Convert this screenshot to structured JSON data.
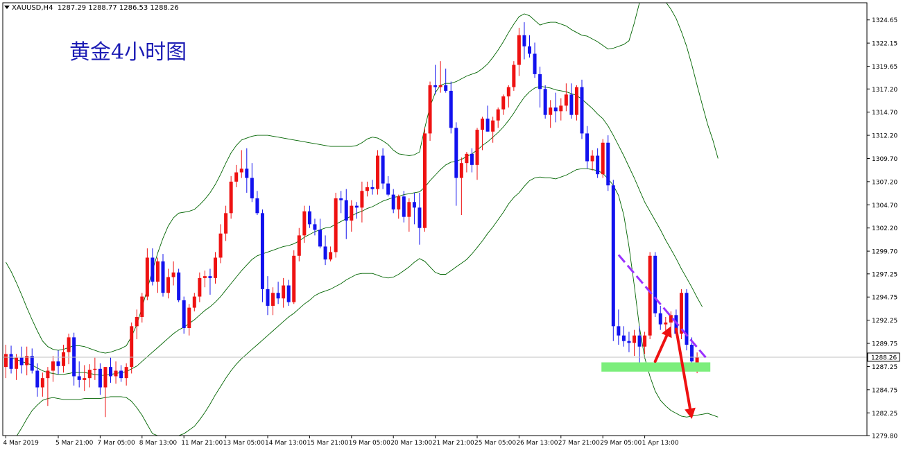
{
  "header": {
    "symbol": "XAUUSD,H4",
    "ohlc": "1287.29 1288.77 1286.53 1288.26"
  },
  "chart_data": {
    "type": "candlestick",
    "title": "黄金4小时图",
    "symbol": "XAUUSD",
    "timeframe": "H4",
    "current_price": 1288.26,
    "current_price_label": "1288.26",
    "ylim": [
      1279.8,
      1326.5
    ],
    "y_ticks": [
      "1324.65",
      "1322.15",
      "1319.65",
      "1317.20",
      "1314.70",
      "1312.20",
      "1309.70",
      "1307.20",
      "1304.70",
      "1302.20",
      "1299.70",
      "1297.25",
      "1294.75",
      "1292.25",
      "1289.75",
      "1287.25",
      "1284.75",
      "1282.25",
      "1279.80"
    ],
    "x_ticks": [
      {
        "label": "4 Mar 2019",
        "index": 0
      },
      {
        "label": "5 Mar 21:00",
        "index": 10
      },
      {
        "label": "7 Mar 05:00",
        "index": 18
      },
      {
        "label": "8 Mar 13:00",
        "index": 26
      },
      {
        "label": "11 Mar 21:00",
        "index": 34
      },
      {
        "label": "13 Mar 05:00",
        "index": 42
      },
      {
        "label": "14 Mar 13:00",
        "index": 50
      },
      {
        "label": "15 Mar 21:00",
        "index": 58
      },
      {
        "label": "19 Mar 05:00",
        "index": 66
      },
      {
        "label": "20 Mar 13:00",
        "index": 74
      },
      {
        "label": "21 Mar 21:00",
        "index": 82
      },
      {
        "label": "25 Mar 05:00",
        "index": 90
      },
      {
        "label": "26 Mar 13:00",
        "index": 98
      },
      {
        "label": "27 Mar 21:00",
        "index": 106
      },
      {
        "label": "29 Mar 05:00",
        "index": 114
      },
      {
        "label": "1 Apr 13:00",
        "index": 122
      }
    ],
    "candles": [
      [
        1287.2,
        1289.6,
        1286.0,
        1288.6
      ],
      [
        1288.6,
        1289.5,
        1286.5,
        1287.0
      ],
      [
        1287.0,
        1288.6,
        1285.8,
        1288.2
      ],
      [
        1288.2,
        1289.4,
        1286.5,
        1287.4
      ],
      [
        1287.4,
        1289.4,
        1286.3,
        1288.4
      ],
      [
        1288.4,
        1289.2,
        1286.5,
        1286.8
      ],
      [
        1286.8,
        1287.6,
        1284.0,
        1285.0
      ],
      [
        1285.0,
        1286.6,
        1284.0,
        1286.0
      ],
      [
        1286.0,
        1287.2,
        1283.0,
        1286.8
      ],
      [
        1286.8,
        1288.4,
        1285.6,
        1287.8
      ],
      [
        1287.8,
        1289.0,
        1286.4,
        1287.3
      ],
      [
        1287.3,
        1289.6,
        1286.6,
        1288.8
      ],
      [
        1288.8,
        1290.8,
        1287.5,
        1290.4
      ],
      [
        1290.4,
        1290.9,
        1285.2,
        1286.2
      ],
      [
        1286.2,
        1287.8,
        1285.0,
        1285.8
      ],
      [
        1285.8,
        1287.4,
        1284.6,
        1286.0
      ],
      [
        1286.0,
        1287.5,
        1285.0,
        1286.9
      ],
      [
        1286.9,
        1288.2,
        1285.8,
        1287.0
      ],
      [
        1287.0,
        1287.6,
        1284.2,
        1285.0
      ],
      [
        1285.0,
        1287.2,
        1281.8,
        1287.2
      ],
      [
        1287.2,
        1288.2,
        1285.5,
        1286.2
      ],
      [
        1286.2,
        1287.8,
        1285.4,
        1286.8
      ],
      [
        1286.8,
        1287.4,
        1285.6,
        1286.0
      ],
      [
        1286.0,
        1287.6,
        1285.2,
        1287.2
      ],
      [
        1287.2,
        1292.0,
        1286.5,
        1291.6
      ],
      [
        1291.6,
        1293.4,
        1290.2,
        1292.6
      ],
      [
        1292.6,
        1295.2,
        1292.0,
        1294.8
      ],
      [
        1294.8,
        1300.0,
        1294.4,
        1299.0
      ],
      [
        1299.0,
        1300.0,
        1296.0,
        1296.4
      ],
      [
        1296.4,
        1299.0,
        1295.2,
        1298.6
      ],
      [
        1298.6,
        1299.4,
        1294.8,
        1295.2
      ],
      [
        1295.2,
        1297.8,
        1294.6,
        1296.9
      ],
      [
        1296.9,
        1298.6,
        1296.0,
        1297.4
      ],
      [
        1297.4,
        1297.8,
        1294.2,
        1294.4
      ],
      [
        1294.4,
        1294.8,
        1290.8,
        1291.4
      ],
      [
        1291.4,
        1294.0,
        1290.6,
        1293.6
      ],
      [
        1293.6,
        1295.2,
        1293.2,
        1294.8
      ],
      [
        1294.8,
        1297.4,
        1294.2,
        1296.8
      ],
      [
        1296.8,
        1297.6,
        1295.8,
        1297.0
      ],
      [
        1297.0,
        1297.8,
        1295.0,
        1296.8
      ],
      [
        1296.8,
        1299.6,
        1296.2,
        1299.0
      ],
      [
        1299.0,
        1302.6,
        1298.4,
        1301.6
      ],
      [
        1301.6,
        1304.6,
        1300.8,
        1303.8
      ],
      [
        1303.8,
        1307.8,
        1303.2,
        1307.2
      ],
      [
        1307.2,
        1309.0,
        1306.6,
        1308.2
      ],
      [
        1308.2,
        1310.6,
        1307.6,
        1308.6
      ],
      [
        1308.6,
        1310.8,
        1306.0,
        1307.6
      ],
      [
        1307.6,
        1309.2,
        1305.0,
        1305.4
      ],
      [
        1305.4,
        1306.2,
        1303.6,
        1303.8
      ],
      [
        1303.8,
        1304.2,
        1294.2,
        1295.6
      ],
      [
        1295.6,
        1297.0,
        1292.8,
        1293.8
      ],
      [
        1293.8,
        1295.8,
        1292.8,
        1295.2
      ],
      [
        1295.2,
        1296.4,
        1294.0,
        1294.6
      ],
      [
        1294.6,
        1296.8,
        1293.6,
        1296.0
      ],
      [
        1296.0,
        1296.6,
        1293.8,
        1294.2
      ],
      [
        1294.2,
        1299.8,
        1294.0,
        1299.2
      ],
      [
        1299.2,
        1302.2,
        1298.6,
        1301.4
      ],
      [
        1301.4,
        1304.6,
        1300.6,
        1304.0
      ],
      [
        1304.0,
        1304.6,
        1302.2,
        1302.6
      ],
      [
        1302.6,
        1303.2,
        1301.4,
        1302.0
      ],
      [
        1302.0,
        1303.2,
        1300.0,
        1300.2
      ],
      [
        1300.2,
        1301.4,
        1298.2,
        1298.8
      ],
      [
        1298.8,
        1300.2,
        1298.6,
        1299.6
      ],
      [
        1299.6,
        1306.0,
        1299.0,
        1305.4
      ],
      [
        1305.4,
        1306.2,
        1303.8,
        1305.2
      ],
      [
        1305.2,
        1306.4,
        1301.0,
        1303.0
      ],
      [
        1303.0,
        1305.2,
        1301.8,
        1304.6
      ],
      [
        1304.6,
        1305.0,
        1303.2,
        1304.4
      ],
      [
        1304.4,
        1307.2,
        1302.8,
        1306.2
      ],
      [
        1306.2,
        1307.2,
        1305.6,
        1306.6
      ],
      [
        1306.6,
        1307.4,
        1305.8,
        1306.4
      ],
      [
        1306.4,
        1310.6,
        1305.8,
        1310.0
      ],
      [
        1310.0,
        1310.8,
        1306.4,
        1307.0
      ],
      [
        1307.0,
        1307.8,
        1305.6,
        1305.8
      ],
      [
        1305.8,
        1306.4,
        1303.8,
        1304.2
      ],
      [
        1304.2,
        1305.8,
        1303.2,
        1305.6
      ],
      [
        1305.6,
        1306.2,
        1302.8,
        1303.4
      ],
      [
        1303.4,
        1305.4,
        1301.8,
        1305.0
      ],
      [
        1305.0,
        1306.0,
        1302.6,
        1304.4
      ],
      [
        1304.4,
        1306.0,
        1300.4,
        1302.2
      ],
      [
        1302.2,
        1313.0,
        1301.8,
        1312.4
      ],
      [
        1312.4,
        1318.0,
        1311.6,
        1317.6
      ],
      [
        1317.6,
        1319.8,
        1316.6,
        1317.4
      ],
      [
        1317.4,
        1320.2,
        1316.8,
        1317.6
      ],
      [
        1317.6,
        1319.4,
        1316.8,
        1317.0
      ],
      [
        1317.0,
        1318.0,
        1312.4,
        1313.0
      ],
      [
        1313.0,
        1313.6,
        1304.6,
        1307.6
      ],
      [
        1307.6,
        1309.8,
        1303.6,
        1309.2
      ],
      [
        1309.2,
        1310.4,
        1308.2,
        1310.2
      ],
      [
        1310.2,
        1310.8,
        1308.2,
        1309.0
      ],
      [
        1309.0,
        1313.0,
        1307.4,
        1312.8
      ],
      [
        1312.8,
        1314.2,
        1310.6,
        1314.0
      ],
      [
        1314.0,
        1315.4,
        1312.6,
        1312.6
      ],
      [
        1312.6,
        1314.2,
        1311.4,
        1313.8
      ],
      [
        1313.8,
        1315.2,
        1313.0,
        1315.0
      ],
      [
        1315.0,
        1316.6,
        1314.4,
        1316.4
      ],
      [
        1316.4,
        1317.6,
        1315.2,
        1317.4
      ],
      [
        1317.4,
        1320.2,
        1317.0,
        1319.8
      ],
      [
        1319.8,
        1323.8,
        1318.6,
        1323.0
      ],
      [
        1323.0,
        1324.4,
        1320.4,
        1321.8
      ],
      [
        1321.8,
        1323.0,
        1320.6,
        1321.0
      ],
      [
        1321.0,
        1322.2,
        1318.4,
        1318.8
      ],
      [
        1318.8,
        1319.6,
        1315.2,
        1317.2
      ],
      [
        1317.2,
        1317.6,
        1314.0,
        1314.4
      ],
      [
        1314.4,
        1316.0,
        1313.0,
        1315.2
      ],
      [
        1315.2,
        1316.8,
        1313.6,
        1314.8
      ],
      [
        1314.8,
        1316.2,
        1313.8,
        1315.4
      ],
      [
        1315.4,
        1317.8,
        1314.8,
        1316.6
      ],
      [
        1316.6,
        1317.8,
        1314.0,
        1314.4
      ],
      [
        1314.4,
        1317.6,
        1313.8,
        1317.4
      ],
      [
        1317.4,
        1318.2,
        1311.8,
        1312.4
      ],
      [
        1312.4,
        1313.2,
        1308.6,
        1309.4
      ],
      [
        1309.4,
        1310.6,
        1308.4,
        1310.0
      ],
      [
        1310.0,
        1310.8,
        1307.6,
        1308.0
      ],
      [
        1308.0,
        1311.8,
        1307.6,
        1311.4
      ],
      [
        1311.4,
        1312.2,
        1306.2,
        1306.8
      ],
      [
        1306.8,
        1307.4,
        1290.0,
        1291.6
      ],
      [
        1291.6,
        1293.4,
        1289.6,
        1290.6
      ],
      [
        1290.6,
        1291.6,
        1289.4,
        1290.0
      ],
      [
        1290.0,
        1291.0,
        1288.8,
        1289.8
      ],
      [
        1289.8,
        1291.2,
        1288.4,
        1290.6
      ],
      [
        1290.6,
        1291.6,
        1287.2,
        1289.4
      ],
      [
        1289.4,
        1291.0,
        1288.6,
        1290.6
      ],
      [
        1290.6,
        1299.6,
        1290.2,
        1299.2
      ],
      [
        1299.2,
        1299.6,
        1292.6,
        1293.0
      ],
      [
        1293.0,
        1293.8,
        1291.2,
        1291.8
      ],
      [
        1291.8,
        1292.6,
        1291.0,
        1292.0
      ],
      [
        1292.0,
        1293.2,
        1291.0,
        1292.8
      ],
      [
        1292.8,
        1293.4,
        1290.6,
        1290.8
      ],
      [
        1290.8,
        1295.6,
        1290.2,
        1295.2
      ],
      [
        1295.2,
        1295.6,
        1289.0,
        1289.6
      ],
      [
        1289.6,
        1290.4,
        1287.2,
        1287.8
      ],
      [
        1287.29,
        1288.77,
        1286.53,
        1288.26
      ]
    ],
    "indicator": {
      "name": "Bollinger Bands",
      "color": "#006400",
      "middle": [
        1288.3,
        1288.2,
        1288.0,
        1287.8,
        1287.6,
        1287.4,
        1287.1,
        1286.8,
        1286.6,
        1286.5,
        1286.4,
        1286.4,
        1286.5,
        1286.6,
        1286.6,
        1286.6,
        1286.5,
        1286.4,
        1286.3,
        1286.3,
        1286.4,
        1286.5,
        1286.6,
        1286.7,
        1287.0,
        1287.3,
        1287.8,
        1288.3,
        1288.8,
        1289.3,
        1289.8,
        1290.3,
        1290.8,
        1291.2,
        1291.5,
        1291.9,
        1292.3,
        1292.8,
        1293.3,
        1293.7,
        1294.2,
        1294.8,
        1295.5,
        1296.2,
        1296.9,
        1297.6,
        1298.2,
        1298.8,
        1299.2,
        1299.4,
        1299.6,
        1299.8,
        1300.0,
        1300.2,
        1300.3,
        1300.5,
        1300.8,
        1301.2,
        1301.5,
        1301.8,
        1302.0,
        1302.2,
        1302.3,
        1302.6,
        1302.9,
        1303.2,
        1303.5,
        1303.8,
        1304.0,
        1304.3,
        1304.5,
        1304.8,
        1305.1,
        1305.3,
        1305.5,
        1305.6,
        1305.8,
        1305.9,
        1306.0,
        1306.1,
        1306.6,
        1307.3,
        1307.9,
        1308.5,
        1309.0,
        1309.3,
        1309.4,
        1309.6,
        1309.9,
        1310.2,
        1310.6,
        1311.1,
        1311.5,
        1312.0,
        1312.5,
        1313.1,
        1313.8,
        1314.6,
        1315.5,
        1316.3,
        1316.9,
        1317.3,
        1317.5,
        1317.4,
        1317.3,
        1317.1,
        1317.0,
        1316.9,
        1316.7,
        1316.5,
        1316.1,
        1315.6,
        1315.1,
        1314.5,
        1314.0,
        1313.2,
        1312.2,
        1311.1,
        1310.0,
        1308.8,
        1307.6,
        1306.3,
        1305.0,
        1304.0,
        1303.0,
        1302.0,
        1300.9,
        1299.9,
        1298.9,
        1297.8,
        1296.8,
        1295.8,
        1294.7,
        1293.7
      ],
      "upper": [
        1298.5,
        1297.5,
        1296.3,
        1295.0,
        1293.6,
        1292.3,
        1291.1,
        1290.0,
        1289.4,
        1289.1,
        1289.0,
        1289.1,
        1289.3,
        1289.5,
        1289.5,
        1289.4,
        1289.2,
        1289.0,
        1288.8,
        1288.7,
        1288.8,
        1289.0,
        1289.2,
        1289.5,
        1290.5,
        1291.8,
        1293.6,
        1295.6,
        1297.6,
        1299.5,
        1301.1,
        1302.4,
        1303.3,
        1303.8,
        1303.9,
        1304.0,
        1304.2,
        1304.7,
        1305.3,
        1306.0,
        1306.9,
        1308.0,
        1309.2,
        1310.3,
        1311.1,
        1311.7,
        1311.9,
        1312.1,
        1312.2,
        1312.2,
        1312.2,
        1312.1,
        1312.0,
        1311.9,
        1311.8,
        1311.7,
        1311.6,
        1311.5,
        1311.4,
        1311.3,
        1311.2,
        1311.1,
        1311.0,
        1311.0,
        1311.0,
        1311.0,
        1311.0,
        1311.1,
        1311.4,
        1311.8,
        1312.0,
        1311.9,
        1311.6,
        1311.2,
        1310.6,
        1310.2,
        1310.1,
        1310.0,
        1310.1,
        1310.4,
        1313.0,
        1315.3,
        1316.8,
        1317.6,
        1317.8,
        1317.8,
        1318.0,
        1318.3,
        1318.6,
        1318.8,
        1319.0,
        1319.4,
        1319.9,
        1320.6,
        1321.4,
        1322.3,
        1323.3,
        1324.2,
        1325.0,
        1325.3,
        1325.1,
        1324.6,
        1324.1,
        1324.3,
        1324.4,
        1324.4,
        1324.2,
        1324.0,
        1323.6,
        1323.3,
        1323.0,
        1322.9,
        1322.6,
        1322.3,
        1321.9,
        1321.5,
        1321.6,
        1321.8,
        1322.0,
        1322.4,
        1324.3,
        1326.5,
        1326.8,
        1326.8,
        1326.8,
        1326.8,
        1326.6,
        1325.8,
        1324.8,
        1323.4,
        1321.8,
        1319.8,
        1317.6,
        1315.5,
        1313.4,
        1311.7,
        1309.7
      ],
      "lower": [
        1278.1,
        1278.9,
        1279.7,
        1280.6,
        1281.6,
        1282.5,
        1283.1,
        1283.6,
        1283.8,
        1283.9,
        1283.8,
        1283.7,
        1283.7,
        1283.7,
        1283.7,
        1283.8,
        1283.8,
        1283.8,
        1283.8,
        1283.9,
        1284.0,
        1284.0,
        1284.0,
        1283.9,
        1283.5,
        1282.8,
        1282.0,
        1281.0,
        1280.0,
        1279.8,
        1279.6,
        1279.6,
        1279.7,
        1279.8,
        1280.0,
        1280.4,
        1280.8,
        1281.5,
        1282.3,
        1283.2,
        1284.2,
        1285.1,
        1286.0,
        1286.8,
        1287.5,
        1288.1,
        1288.6,
        1289.1,
        1289.6,
        1290.1,
        1290.6,
        1291.1,
        1291.6,
        1292.1,
        1292.6,
        1293.0,
        1293.5,
        1294.0,
        1294.4,
        1294.9,
        1295.2,
        1295.4,
        1295.6,
        1295.9,
        1296.2,
        1296.6,
        1296.9,
        1297.2,
        1297.3,
        1297.3,
        1297.3,
        1297.1,
        1296.9,
        1296.8,
        1296.9,
        1297.2,
        1297.6,
        1298.0,
        1298.5,
        1298.9,
        1298.6,
        1298.0,
        1297.4,
        1297.2,
        1297.2,
        1297.6,
        1298.0,
        1298.4,
        1298.8,
        1299.4,
        1300.1,
        1300.8,
        1301.6,
        1302.3,
        1303.1,
        1303.9,
        1304.8,
        1305.5,
        1306.0,
        1306.7,
        1307.3,
        1307.6,
        1307.7,
        1307.6,
        1307.6,
        1307.5,
        1307.7,
        1307.9,
        1308.2,
        1308.5,
        1308.6,
        1308.6,
        1308.5,
        1308.4,
        1308.1,
        1307.5,
        1306.8,
        1305.7,
        1303.6,
        1300.2,
        1296.0,
        1291.5,
        1288.2,
        1286.2,
        1284.6,
        1283.6,
        1283.0,
        1282.5,
        1282.2,
        1281.9,
        1281.8,
        1281.9,
        1282.0,
        1282.1,
        1282.2,
        1282.0,
        1281.8
      ]
    },
    "annotations": {
      "support_zone": {
        "from_index": 114,
        "to_index": 134,
        "y_low": 1286.7,
        "y_high": 1287.7,
        "color": "#7cee7c"
      },
      "trendline": {
        "from_index": 117,
        "from_y": 1299.3,
        "to_index": 134,
        "to_y": 1288.0,
        "color": "#9b30ff"
      },
      "arrows": [
        {
          "from_index": 124,
          "from_y": 1287.8,
          "to_index": 127,
          "to_y": 1291.6,
          "color": "#ee1111"
        },
        {
          "from_index": 128,
          "from_y": 1291.3,
          "to_index": 131,
          "to_y": 1281.6,
          "color": "#ee1111"
        }
      ]
    },
    "colors": {
      "bull": "#ee1111",
      "bear": "#1212ee",
      "frame": "#000000",
      "price_line": "#c0c0c0"
    }
  }
}
